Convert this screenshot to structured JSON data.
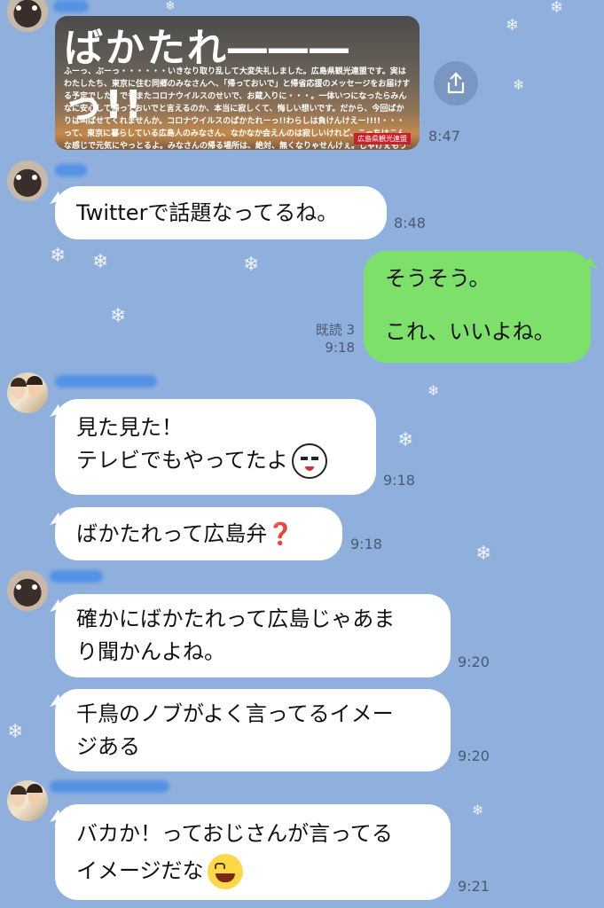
{
  "image_message": {
    "title": "ばかたれ―――っ!!",
    "body": "ふーっ、ぶーっ・・・・・・いきなり取り乱して大変失礼しました。広島県観光連盟です。実はわたしたち、東京に住む同郷のみなさんへ、「帰っておいで」と帰省応援のメッセージをお届けする予定でした。でもまたコロナウイルスのせいで、お蔵入りに・・・。一体いつになったらみんなに安心して帰っておいでと言えるのか、本当に寂しくて、悔しい想いです。だから、今回ばかりは叫ばせてくれませんか。コロナウイルスのばかたれーっ!!わらしは負けんけえー!!!!・・・って、東京に暮らしている広島人のみなさん、なかなか会えんのは寂しいけれど、こっちはこんな感じで元気にやっとるよ。みなさんの帰る場所は、絶対、無くなりゃせんけぇ。じゃけぇもうひと踏ん張り。一緒に頑張ろうや。また会えるのを、待っとるけぇ。",
    "badge": "広島県観光連盟",
    "time": "8:47"
  },
  "messages": [
    {
      "text": "Twitterで話題なってるね。",
      "time": "8:48"
    },
    {
      "line1": "そうそう。",
      "line2": "これ、いいよね。",
      "read": "既読 3",
      "time": "9:18"
    },
    {
      "line1": "見た見た！",
      "line2": "テレビでもやってたよ",
      "emoji": "smiling-face-sticker-emoji",
      "time": "9:18"
    },
    {
      "text": "ばかたれって広島弁",
      "qmark": "❓",
      "time": "9:18"
    },
    {
      "line1": "確かにばかたれって広島じゃあま",
      "line2": "り聞かんよね。",
      "time": "9:20"
    },
    {
      "line1": "千鳥のノブがよく言ってるイメー",
      "line2": "ジある",
      "time": "9:20"
    },
    {
      "line1": "バカか！っておじさんが言ってる",
      "line2": "イメージだな",
      "emoji": "grinning-sweat-emoji",
      "time": "9:21"
    }
  ],
  "colors": {
    "background": "#8fb0dc",
    "outgoing_bubble": "#7de06b",
    "incoming_bubble": "#ffffff"
  }
}
